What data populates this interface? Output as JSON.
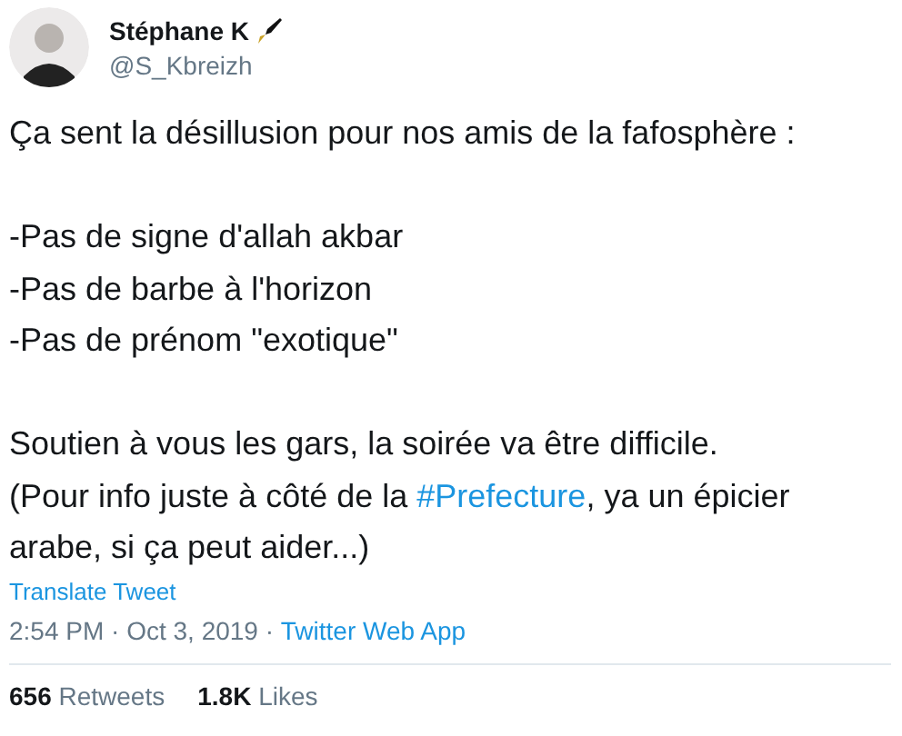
{
  "author": {
    "name": "Stéphane K",
    "handle": "@S_Kbreizh"
  },
  "body": [
    {
      "kind": "text",
      "text": "Ça sent la désillusion pour nos amis de la fafosphère :"
    },
    {
      "kind": "lines",
      "lines": [
        "-Pas de signe d'allah akbar",
        "-Pas de barbe à l'horizon",
        "-Pas de prénom \"exotique\""
      ]
    },
    {
      "kind": "rich",
      "segments": [
        {
          "kind": "text",
          "text": "Soutien à vous les gars, la soirée va être difficile.\n(Pour info juste à côté de la "
        },
        {
          "kind": "link",
          "text": "#Prefecture"
        },
        {
          "kind": "text",
          "text": ", ya un épicier arabe, si ça peut aider...)"
        }
      ]
    }
  ],
  "translate": "Translate Tweet",
  "meta": {
    "time": "2:54 PM · Oct 3, 2019 · ",
    "source": "Twitter Web App"
  },
  "stats": [
    "**656** Retweets",
    "**1.8K** Likes"
  ]
}
